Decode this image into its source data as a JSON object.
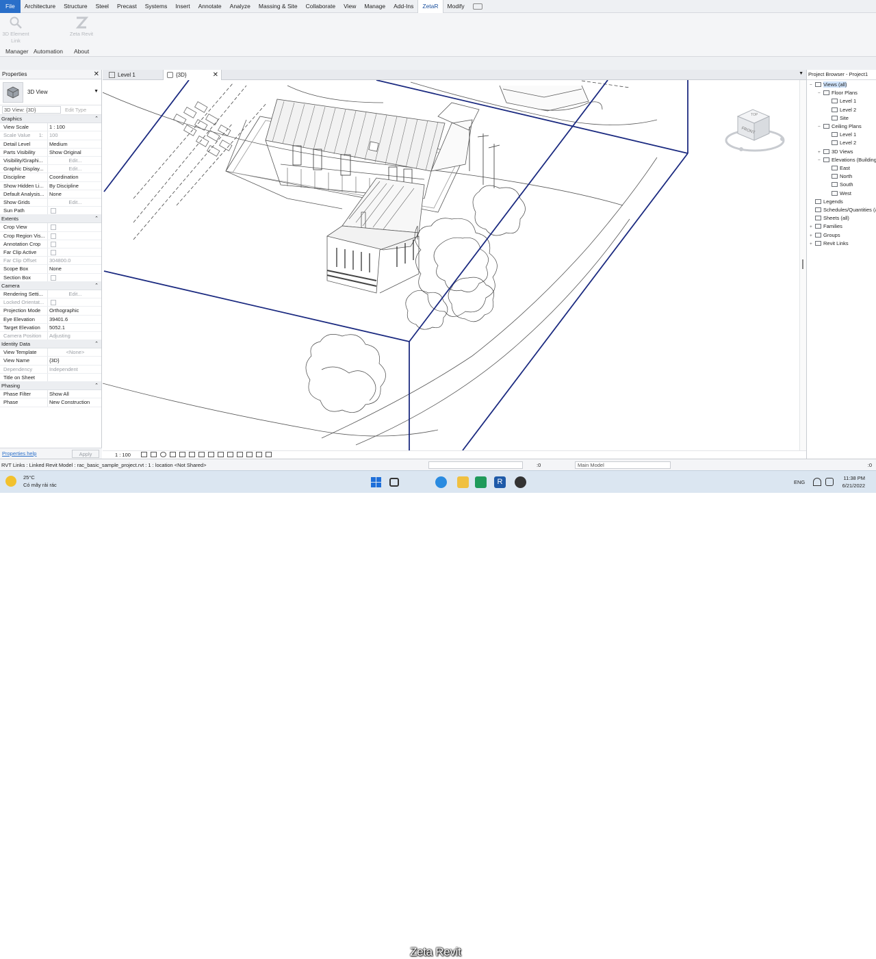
{
  "menubar": {
    "items": [
      "File",
      "Architecture",
      "Structure",
      "Steel",
      "Precast",
      "Systems",
      "Insert",
      "Annotate",
      "Analyze",
      "Massing & Site",
      "Collaborate",
      "View",
      "Manage",
      "Add-Ins",
      "ZetaR",
      "Modify"
    ],
    "active": "ZetaR"
  },
  "ribbon": {
    "buttons": [
      {
        "label": "3D Element Link",
        "icon": "magnifier-icon"
      },
      {
        "label": "Zeta Revit",
        "icon": "zeta-logo-icon"
      }
    ],
    "panels": [
      "Manager",
      "Automation",
      "About"
    ]
  },
  "properties": {
    "title": "Properties",
    "type_name": "3D View",
    "instance_selector": "3D View: {3D}",
    "edit_type": "Edit Type",
    "groups": [
      {
        "name": "Graphics",
        "rows": [
          {
            "name": "View Scale",
            "value": "1 : 100"
          },
          {
            "name": "Scale Value",
            "scale_prefix": "1:",
            "value": "100",
            "dim": true
          },
          {
            "name": "Detail Level",
            "value": "Medium"
          },
          {
            "name": "Parts Visibility",
            "value": "Show Original"
          },
          {
            "name": "Visibility/Graphi...",
            "value": "Edit...",
            "button": true
          },
          {
            "name": "Graphic Display...",
            "value": "Edit...",
            "button": true
          },
          {
            "name": "Discipline",
            "value": "Coordination"
          },
          {
            "name": "Show Hidden Li...",
            "value": "By Discipline"
          },
          {
            "name": "Default Analysis...",
            "value": "None"
          },
          {
            "name": "Show Grids",
            "value": "Edit...",
            "button": true
          },
          {
            "name": "Sun Path",
            "value": "",
            "checkbox": true
          }
        ]
      },
      {
        "name": "Extents",
        "rows": [
          {
            "name": "Crop View",
            "value": "",
            "checkbox": true
          },
          {
            "name": "Crop Region Vis...",
            "value": "",
            "checkbox": true
          },
          {
            "name": "Annotation Crop",
            "value": "",
            "checkbox": true
          },
          {
            "name": "Far Clip Active",
            "value": "",
            "checkbox": true
          },
          {
            "name": "Far Clip Offset",
            "value": "304800.0",
            "dim": true
          },
          {
            "name": "Scope Box",
            "value": "None"
          },
          {
            "name": "Section Box",
            "value": "",
            "checkbox": true
          }
        ]
      },
      {
        "name": "Camera",
        "rows": [
          {
            "name": "Rendering Setti...",
            "value": "Edit...",
            "button": true
          },
          {
            "name": "Locked Orientat...",
            "value": "",
            "checkbox": true,
            "dim": true
          },
          {
            "name": "Projection Mode",
            "value": "Orthographic"
          },
          {
            "name": "Eye Elevation",
            "value": "39401.6"
          },
          {
            "name": "Target Elevation",
            "value": "5052.1"
          },
          {
            "name": "Camera Position",
            "value": "Adjusting",
            "dim": true
          }
        ]
      },
      {
        "name": "Identity Data",
        "rows": [
          {
            "name": "View Template",
            "value": "<None>",
            "button": true
          },
          {
            "name": "View Name",
            "value": "{3D}"
          },
          {
            "name": "Dependency",
            "value": "Independent",
            "dim": true
          },
          {
            "name": "Title on Sheet",
            "value": ""
          }
        ]
      },
      {
        "name": "Phasing",
        "rows": [
          {
            "name": "Phase Filter",
            "value": "Show All"
          },
          {
            "name": "Phase",
            "value": "New Construction"
          }
        ]
      }
    ],
    "help_link": "Properties help",
    "apply": "Apply"
  },
  "tabs": [
    {
      "label": "Level 1",
      "active": false
    },
    {
      "label": "{3D}",
      "active": true
    }
  ],
  "viewcube": {
    "top": "TOP",
    "front": "FRONT"
  },
  "view_control": {
    "scale": "1 : 100"
  },
  "browser": {
    "title": "Project Browser - Project1",
    "nodes": [
      {
        "label": "Views (all)",
        "depth": 0,
        "toggle": "−",
        "selected": true
      },
      {
        "label": "Floor Plans",
        "depth": 1,
        "toggle": "−"
      },
      {
        "label": "Level 1",
        "depth": 2,
        "toggle": ""
      },
      {
        "label": "Level 2",
        "depth": 2,
        "toggle": ""
      },
      {
        "label": "Site",
        "depth": 2,
        "toggle": ""
      },
      {
        "label": "Ceiling Plans",
        "depth": 1,
        "toggle": "−"
      },
      {
        "label": "Level 1",
        "depth": 2,
        "toggle": ""
      },
      {
        "label": "Level 2",
        "depth": 2,
        "toggle": ""
      },
      {
        "label": "3D Views",
        "depth": 1,
        "toggle": "+"
      },
      {
        "label": "Elevations (Building Elevation)",
        "depth": 1,
        "toggle": "−"
      },
      {
        "label": "East",
        "depth": 2,
        "toggle": ""
      },
      {
        "label": "North",
        "depth": 2,
        "toggle": ""
      },
      {
        "label": "South",
        "depth": 2,
        "toggle": ""
      },
      {
        "label": "West",
        "depth": 2,
        "toggle": ""
      },
      {
        "label": "Legends",
        "depth": 0,
        "toggle": ""
      },
      {
        "label": "Schedules/Quantities (all)",
        "depth": 0,
        "toggle": ""
      },
      {
        "label": "Sheets (all)",
        "depth": 0,
        "toggle": ""
      },
      {
        "label": "Families",
        "depth": 0,
        "toggle": "+"
      },
      {
        "label": "Groups",
        "depth": 0,
        "toggle": "+"
      },
      {
        "label": "Revit Links",
        "depth": 0,
        "toggle": "+"
      }
    ]
  },
  "status": {
    "message": "RVT Links : Linked Revit Model : rac_basic_sample_project.rvt : 1 : location <Not Shared>",
    "selection_count": ":0",
    "model": "Main Model",
    "filter_count": ":0"
  },
  "taskbar": {
    "temp": "25°C",
    "weather": "Có mây rải rác",
    "lang": "ENG",
    "time": "11:38 PM",
    "date": "6/21/2022"
  },
  "overlay": {
    "text": "Zeta Revit"
  },
  "colors": {
    "accent": "#2a6fc9",
    "scope_box": "#1b2a80"
  }
}
